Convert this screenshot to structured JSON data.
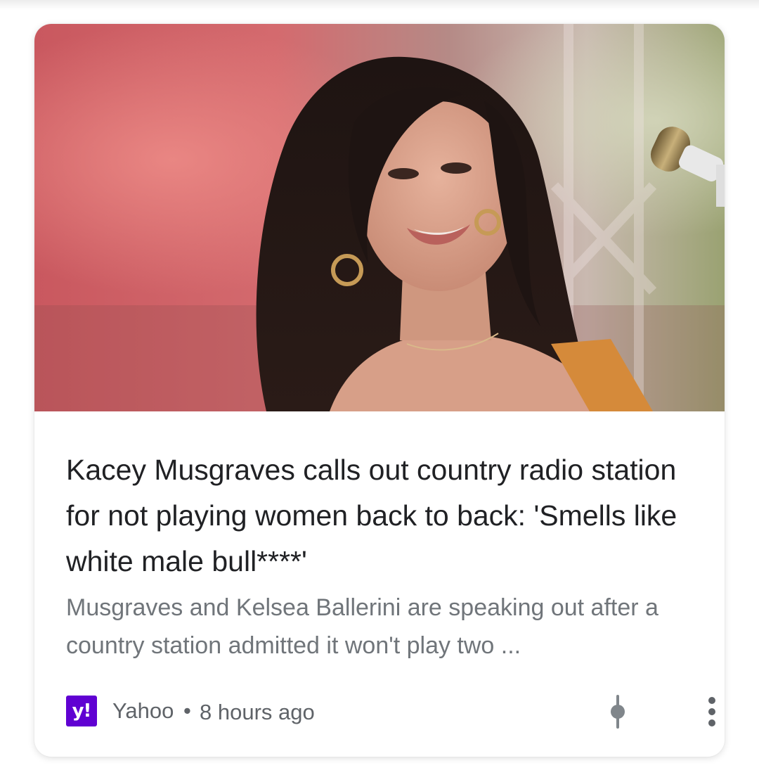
{
  "article": {
    "title": "Kacey Musgraves calls out country radio station for not playing women back to back: 'Smells like white male bull****'",
    "snippet": "Musgraves and Kelsea Ballerini are speaking out after a country station admitted it won't play two ...",
    "source": {
      "logo_text": "y!",
      "name": "Yahoo",
      "separator": "•",
      "time": "8 hours ago"
    },
    "thumbnail_icon": "photo-thumbnail",
    "colors": {
      "logo_bg": "#6001d2",
      "title": "#202124",
      "meta": "#70757a"
    }
  }
}
